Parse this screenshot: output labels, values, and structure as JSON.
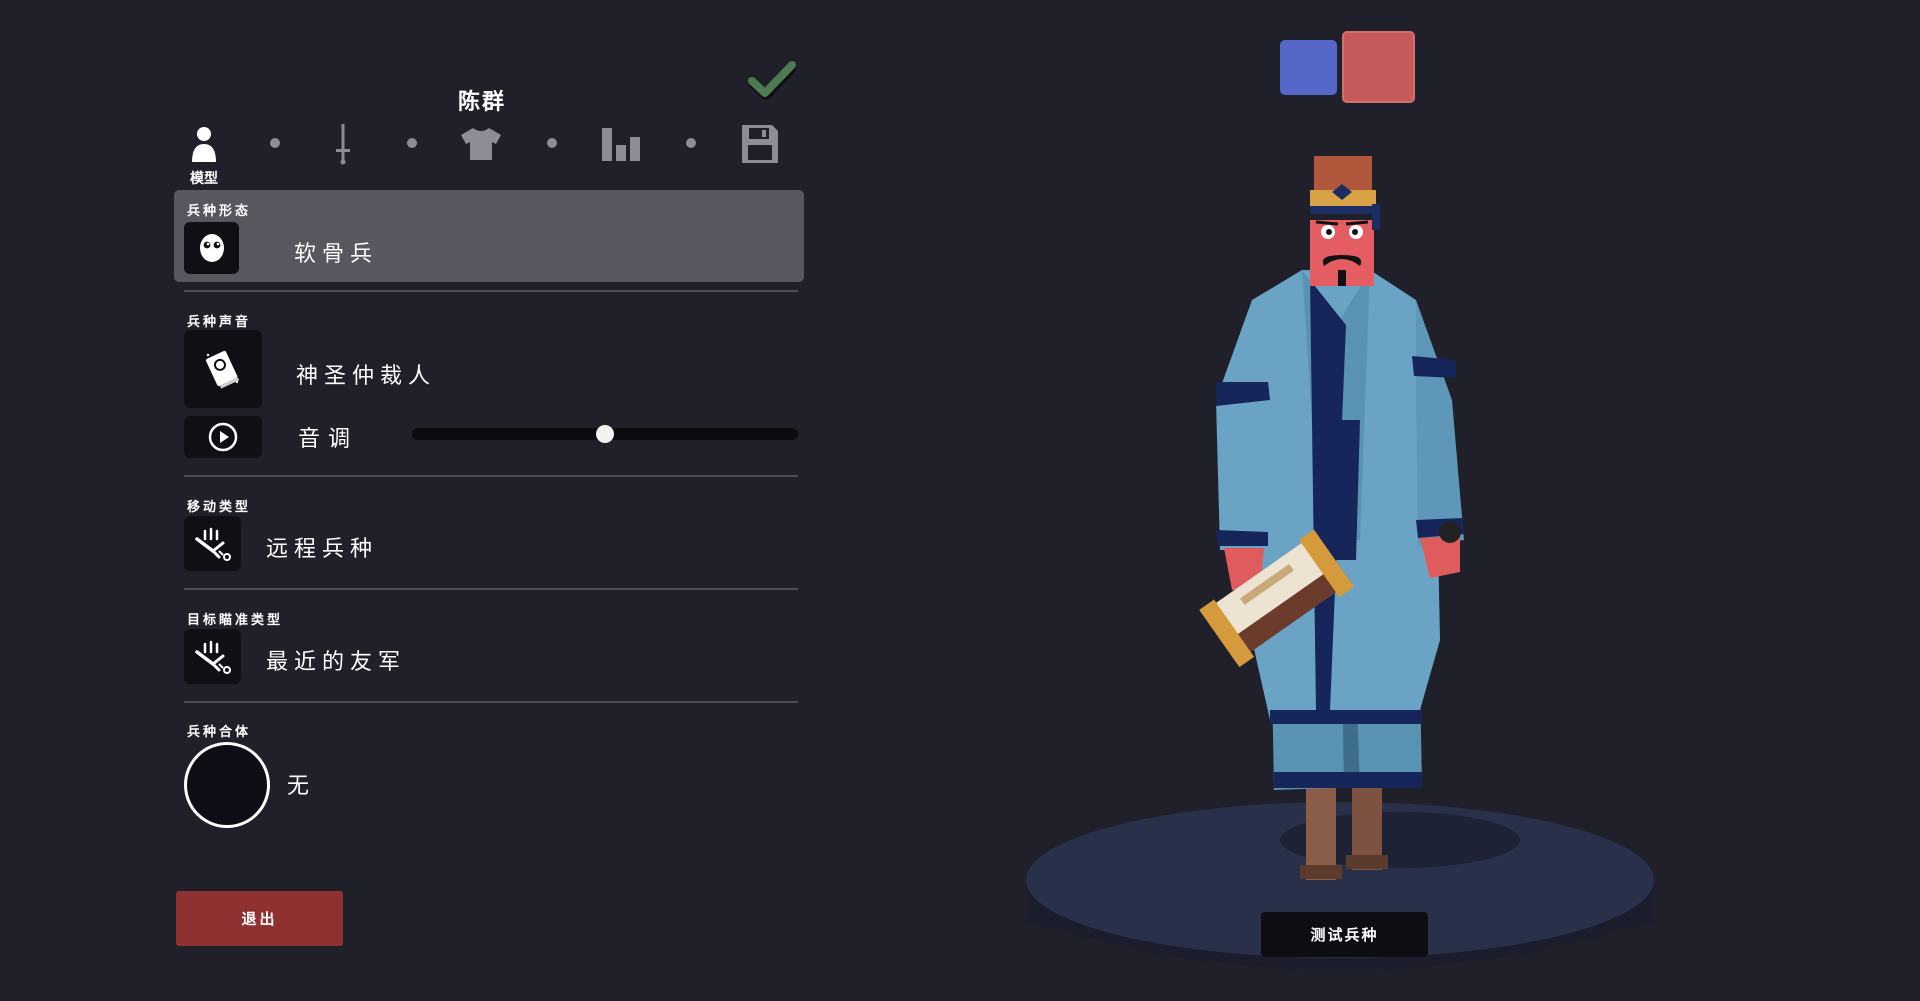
{
  "unit": {
    "name": "陈群"
  },
  "steps": {
    "active_label": "模型",
    "items": [
      "person-icon",
      "sword-icon",
      "shirt-icon",
      "stats-icon",
      "save-icon"
    ]
  },
  "unit_form": {
    "label": "兵种形态",
    "value": "软骨兵"
  },
  "unit_voice": {
    "label": "兵种声音",
    "value": "神圣仲裁人",
    "pitch_label": "音调",
    "pitch_value": 0.5
  },
  "movement": {
    "label": "移动类型",
    "value": "远程兵种"
  },
  "targeting": {
    "label": "目标瞄准类型",
    "value": "最近的友军"
  },
  "combination": {
    "label": "兵种合体",
    "value": "无"
  },
  "buttons": {
    "exit": "退出",
    "test_unit": "测试兵种"
  },
  "teams": {
    "blue": "#5568c9",
    "red": "#c65a5a"
  },
  "colors": {
    "accent_check": "#4e7a52",
    "exit_bg": "#8f3131",
    "background": "#20202b"
  }
}
